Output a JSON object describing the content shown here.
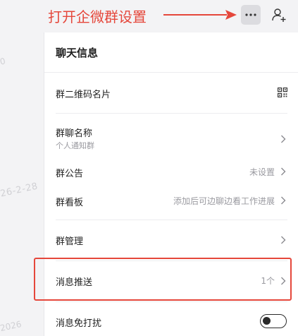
{
  "annotation": {
    "text": "打开企微群设置"
  },
  "topbar": {
    "more_icon": "more-horizontal-icon",
    "add_member_icon": "add-member-icon"
  },
  "background": {
    "date_text": "26-2-28",
    "date_text_2": "2026",
    "mark_text": "0"
  },
  "panel": {
    "title": "聊天信息",
    "rows": [
      {
        "label": "群二维码名片",
        "icon": "qr-code-icon"
      },
      {
        "label": "群聊名称",
        "sub": "个人通知群"
      },
      {
        "label": "群公告",
        "value": "未设置"
      },
      {
        "label": "群看板",
        "value": "添加后可边聊边看工作进展"
      },
      {
        "label": "群管理"
      },
      {
        "label": "消息推送",
        "value": "1个"
      },
      {
        "label": "消息免打扰",
        "toggle": false
      }
    ]
  },
  "colors": {
    "annotation": "#e5473b",
    "highlight": "#e5473b",
    "panel_bg": "#ffffff",
    "page_bg": "#f3f3f5"
  }
}
